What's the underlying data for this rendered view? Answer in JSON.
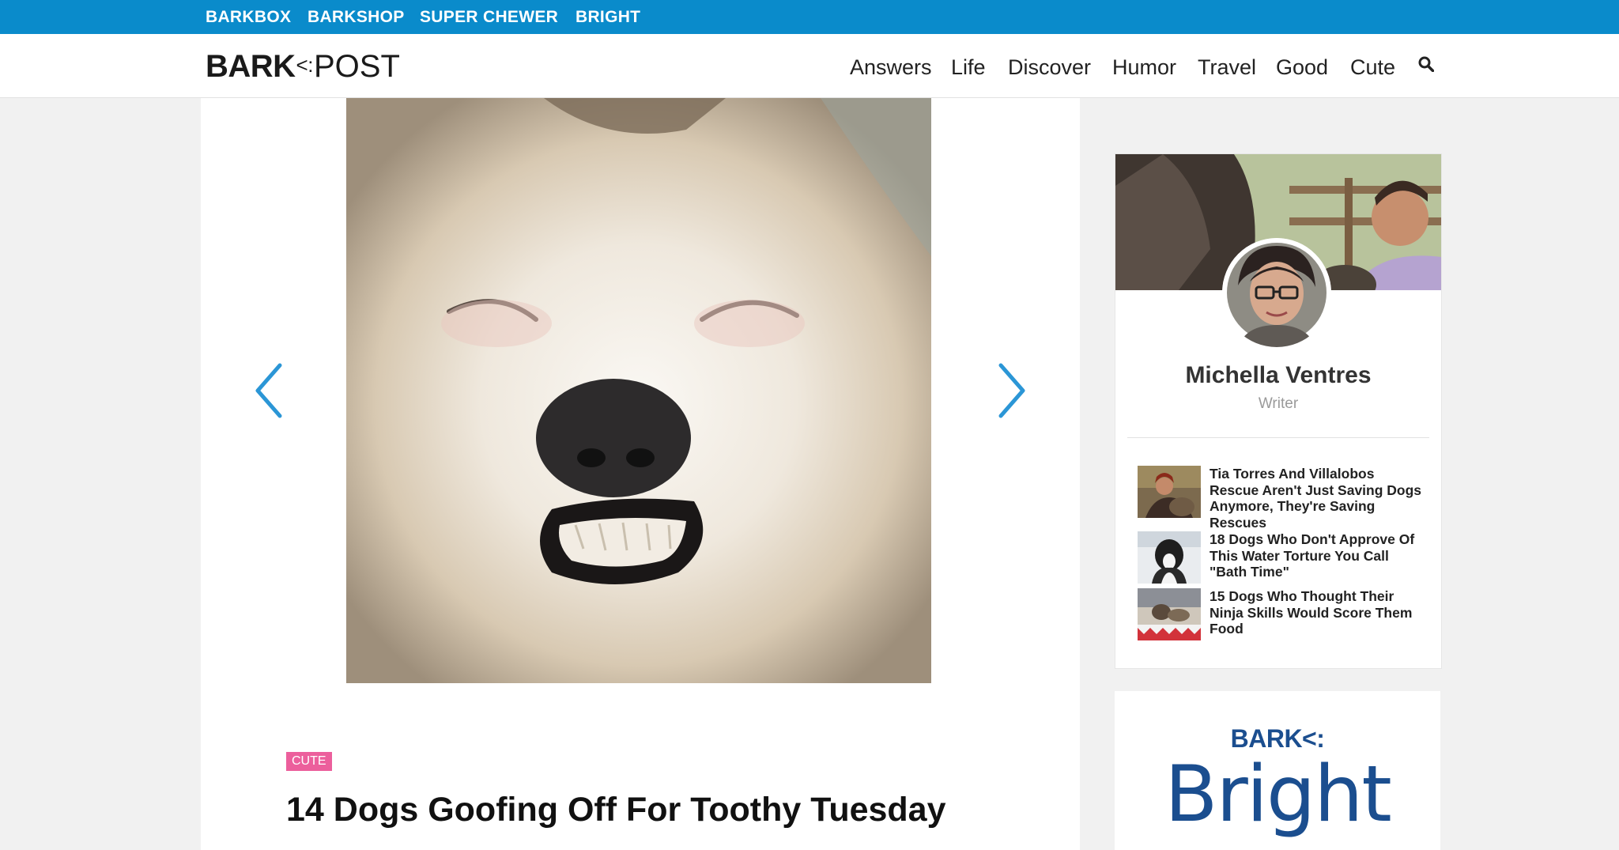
{
  "topbar": {
    "links": [
      "BARKBOX",
      "BARKSHOP",
      "SUPER CHEWER",
      "BRIGHT"
    ]
  },
  "header": {
    "logo_left": "BARK",
    "logo_mark": "<:",
    "logo_right": "POST",
    "nav": [
      "Answers",
      "Life",
      "Discover",
      "Humor",
      "Travel",
      "Good",
      "Cute"
    ],
    "search_icon": "search-icon"
  },
  "article": {
    "tag": "CUTE",
    "title": "14 Dogs Goofing Off For Toothy Tuesday",
    "prev_icon": "chevron-left-icon",
    "next_icon": "chevron-right-icon"
  },
  "author": {
    "name": "Michella Ventres",
    "role": "Writer"
  },
  "related": [
    {
      "title": "Tia Torres And Villalobos Rescue Aren't Just Saving Dogs Anymore, They're Saving Rescues"
    },
    {
      "title": "18 Dogs Who Don't Approve Of This Water Torture You Call \"Bath Time\""
    },
    {
      "title": "15 Dogs Who Thought Their Ninja Skills Would Score Them Food"
    }
  ],
  "ad": {
    "brand_top": "BARK<:",
    "brand_main": "Bright"
  },
  "colors": {
    "topbar": "#0a8bcb",
    "arrow": "#2b96d6",
    "tag": "#ec5f9c",
    "ad_brand": "#1b4e8f"
  }
}
